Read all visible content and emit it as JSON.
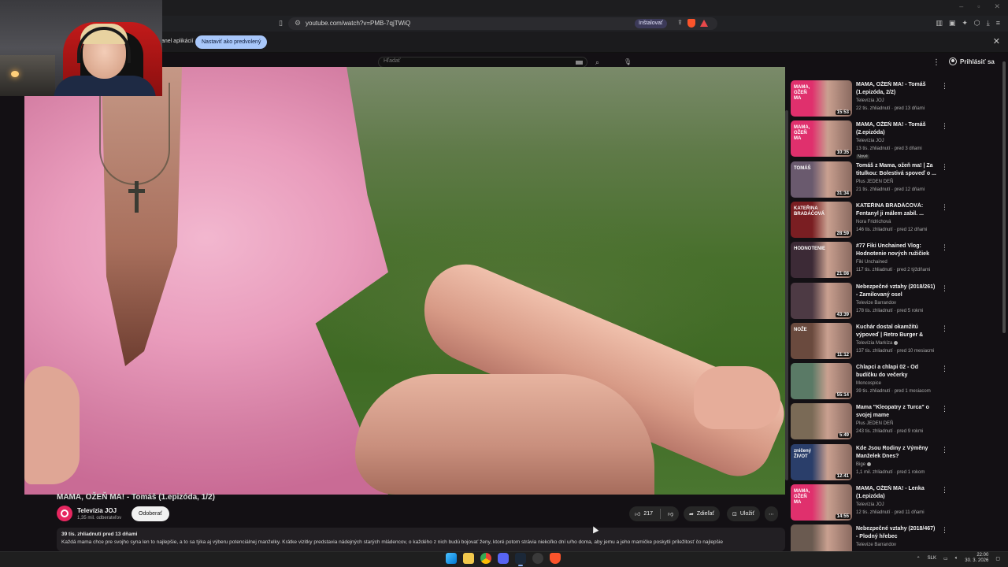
{
  "browser": {
    "url": "youtube.com/watch?v=PMB-7qjTWiQ",
    "install_label": "Inštalovať",
    "infobar_message": "anel aplikácií",
    "set_default_label": "Nastaviť ako predvolený"
  },
  "youtube": {
    "search_placeholder": "Hľadať",
    "signin_label": "Prihlásiť sa"
  },
  "video": {
    "title": "MAMA, OŽEŇ MA! - Tomáš (1.epizóda, 1/2)",
    "channel_name": "Televízia JOJ",
    "subscribers": "1,35 mil. odberateľov",
    "subscribe_label": "Odoberať",
    "likes": "217",
    "share_label": "Zdieľať",
    "save_label": "Uložiť",
    "views_date": "39 tis. zhliadnutí  pred 13 dňami",
    "description": "Každá mama chce pre svojho syna len to najlepšie, a to sa týka aj výberu potenciálnej manželky. Krátke vizitky predstavia nádejných starých mládencov, o každého z nich budú bojovať ženy, ktoré potom strávia niekoľko dní u/ho doma, aby jemu a jeho mamičke poskytli príležitosť čo najlepšie"
  },
  "related": [
    {
      "title": "MAMA, OŽEŇ MA! - Tomáš (1.epizóda, 2/2)",
      "channel": "Televízia JOJ",
      "verified": false,
      "meta": "22 tis. zhliadnutí · pred 13 dňami",
      "duration": "15:53",
      "thumb_label": "MAMA, OŽEŇ MA",
      "thumb_color": "#e0306d",
      "badge": ""
    },
    {
      "title": "MAMA, OŽEŇ MA! - Tomáš (2.epizóda)",
      "channel": "Televízia JOJ",
      "verified": false,
      "meta": "13 tis. zhliadnutí · pred 3 dňami",
      "duration": "10:35",
      "thumb_label": "MAMA, OŽEŇ MA",
      "thumb_color": "#e0306d",
      "badge": "Nové"
    },
    {
      "title": "Tomáš z Mama, ožeň ma! | Za titulkou: Bolestivá spoveď o ...",
      "channel": "Plus JEDEN DEŇ",
      "verified": false,
      "meta": "21 tis. zhliadnutí · pred 12 dňami",
      "duration": "31:34",
      "thumb_label": "TOMÁŠ",
      "thumb_color": "#6a5a6e",
      "badge": ""
    },
    {
      "title": "KATEŘINA BRADÁČOVÁ: Fentanyl ji málem zabil. ...",
      "channel": "Nora Fridrichová",
      "verified": false,
      "meta": "146 tis. zhliadnutí · pred 12 dňami",
      "duration": "28:59",
      "thumb_label": "KATEŘINA BRADÁČOVÁ",
      "thumb_color": "#7a1e22",
      "badge": ""
    },
    {
      "title": "#77 Fiki Unchained Vlog: Hodnotenie nových ružičiek",
      "channel": "Fiki Unchained",
      "verified": false,
      "meta": "117 tis. zhliadnutí · pred 2 týždňami",
      "duration": "21:08",
      "thumb_label": "HODNOTENIE",
      "thumb_color": "#3c2a36",
      "badge": ""
    },
    {
      "title": "Nebezpečné vztahy (2018/261) - Zamilovaný osel",
      "channel": "Televize Barrandov",
      "verified": false,
      "meta": "178 tis. zhliadnutí · pred 5 rokmi",
      "duration": "43:39",
      "thumb_label": "",
      "thumb_color": "#4d3a44",
      "badge": ""
    },
    {
      "title": "Kuchár dostal okamžitú výpoveď | Retro Burger & Dinn...",
      "channel": "Televízia Markíza",
      "verified": true,
      "meta": "137 tis. zhliadnutí · pred 10 mesiacmi",
      "duration": "11:12",
      "thumb_label": "NOŽE",
      "thumb_color": "#6a4a3e",
      "badge": ""
    },
    {
      "title": "Chlapci a chlapi 02 - Od budíčku do večerky",
      "channel": "Moncospice",
      "verified": false,
      "meta": "39 tis. zhliadnutí · pred 1 mesiacom",
      "duration": "55:14",
      "thumb_label": "",
      "thumb_color": "#5a7a66",
      "badge": ""
    },
    {
      "title": "Mama \"Kleopatry z Turca\" o svojej mame",
      "channel": "Plus JEDEN DEŇ",
      "verified": false,
      "meta": "243 tis. zhliadnutí · pred 9 rokmi",
      "duration": "5:49",
      "thumb_label": "",
      "thumb_color": "#7a6a56",
      "badge": ""
    },
    {
      "title": "Kde Jsou Rodiny z Výměny Manželek Dnes?",
      "channel": "Bige",
      "verified": true,
      "meta": "1,1 mil. zhliadnutí · pred 1 rokom",
      "duration": "12:41",
      "thumb_label": "zničený ŽIVOT",
      "thumb_color": "#2a3e6a",
      "badge": ""
    },
    {
      "title": "MAMA, OŽEŇ MA! - Lenka (1.epizóda)",
      "channel": "Televízia JOJ",
      "verified": false,
      "meta": "12 tis. zhliadnutí · pred 11 dňami",
      "duration": "14:55",
      "thumb_label": "MAMA, OŽEŇ MA",
      "thumb_color": "#e0306d",
      "badge": ""
    },
    {
      "title": "Nebezpečné vztahy (2018/467) - Plodný hřebec",
      "channel": "Televize Barrandov",
      "verified": false,
      "meta": "",
      "duration": "",
      "thumb_label": "",
      "thumb_color": "#6a5a50",
      "badge": ""
    }
  ],
  "taskbar": {
    "lang": "SLK",
    "time": "22:00",
    "date": "30. 3. 2026"
  }
}
